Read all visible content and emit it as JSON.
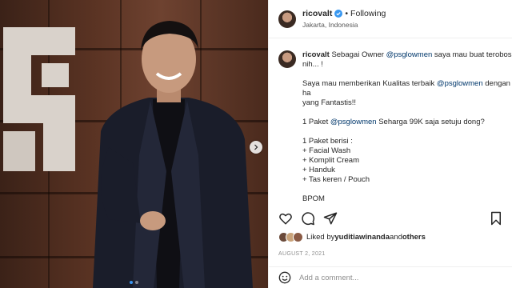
{
  "post": {
    "username": "ricovalt",
    "separator": "•",
    "follow_status": "Following",
    "location": "Jakarta, Indonesia",
    "date": "AUGUST 2, 2021"
  },
  "caption": {
    "username": "ricovalt",
    "segments": [
      {
        "text": "Sebagai Owner ",
        "mention": false
      },
      {
        "text": "@psglowmen",
        "mention": true
      },
      {
        "text": " saya mau buat terobos\nnih... !\n\nSaya mau memberikan Kualitas terbaik ",
        "mention": false
      },
      {
        "text": "@psglowmen",
        "mention": true
      },
      {
        "text": " dengan ha\nyang Fantastis!!\n\n1 Paket ",
        "mention": false
      },
      {
        "text": "@psglowmen",
        "mention": true
      },
      {
        "text": " Seharga 99K saja setuju dong?\n\n1 Paket berisi :\n+ Facial Wash\n+ Komplit Cream\n+ Handuk\n+ Tas keren / Pouch\n\nBPOM\nKemasan Printing",
        "mention": false
      }
    ]
  },
  "likes": {
    "prefix": "Liked by ",
    "user": "yuditiawinanda",
    "joiner": " and ",
    "others": "others"
  },
  "comment": {
    "placeholder": "Add a comment..."
  },
  "icons": {
    "verified": "verified-badge-icon",
    "like": "heart-icon",
    "comment": "comment-bubble-icon",
    "share": "paper-plane-icon",
    "save": "bookmark-icon",
    "next": "chevron-right-icon",
    "emoji": "smiley-icon"
  },
  "carousel": {
    "slides": 2,
    "active": 1
  },
  "colors": {
    "verified": "#3897f0",
    "mention": "#00376b",
    "active_dot": "#3b95f0"
  }
}
